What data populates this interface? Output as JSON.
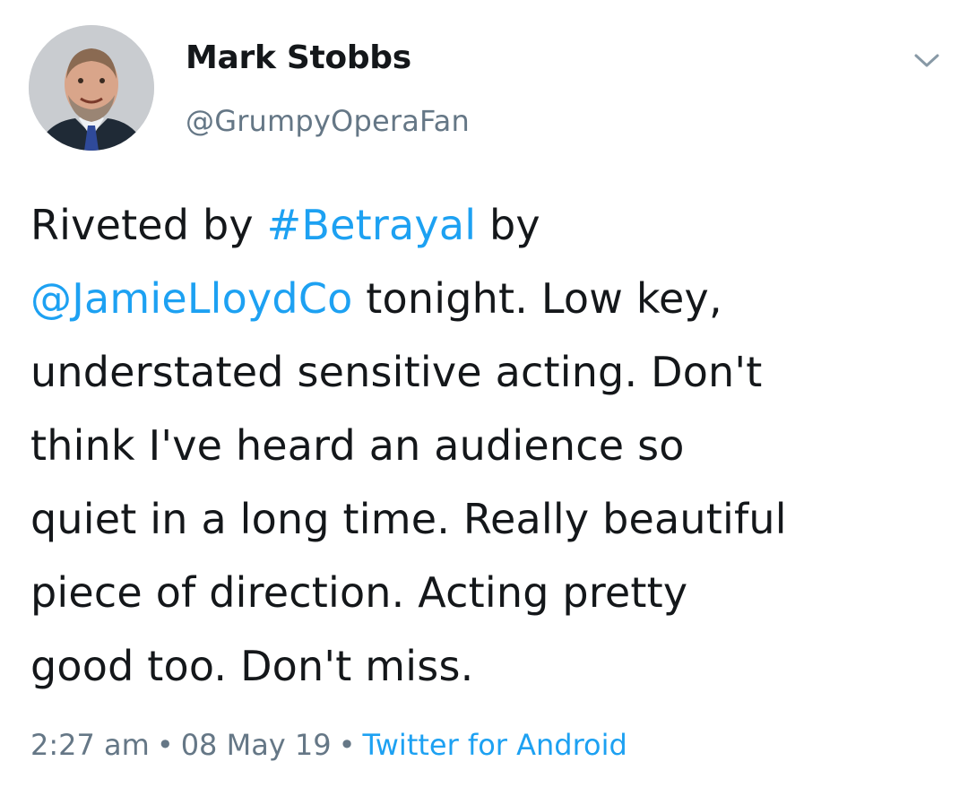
{
  "author": {
    "name": "Mark Stobbs",
    "handle": "@GrumpyOperaFan"
  },
  "tweet": {
    "lines": [
      [
        {
          "text": "Riveted by ",
          "link": false
        },
        {
          "text": "#Betrayal",
          "link": true
        },
        {
          "text": " by",
          "link": false
        }
      ],
      [
        {
          "text": "@JamieLloydCo",
          "link": true
        },
        {
          "text": " tonight. Low key,",
          "link": false
        }
      ],
      [
        {
          "text": "understated sensitive acting. Don't",
          "link": false
        }
      ],
      [
        {
          "text": "think I've heard an audience so",
          "link": false
        }
      ],
      [
        {
          "text": "quiet in a long time. Really beautiful",
          "link": false
        }
      ],
      [
        {
          "text": "piece of direction. Acting pretty",
          "link": false
        }
      ],
      [
        {
          "text": "good too. Don't miss.",
          "link": false
        }
      ]
    ]
  },
  "meta": {
    "time": "2:27 am",
    "separator": "•",
    "date": "08 May 19",
    "source": "Twitter for Android"
  },
  "colors": {
    "link": "#1da1f2",
    "muted": "#657786",
    "text": "#14171a"
  },
  "icons": {
    "menu": "chevron-down-icon"
  }
}
